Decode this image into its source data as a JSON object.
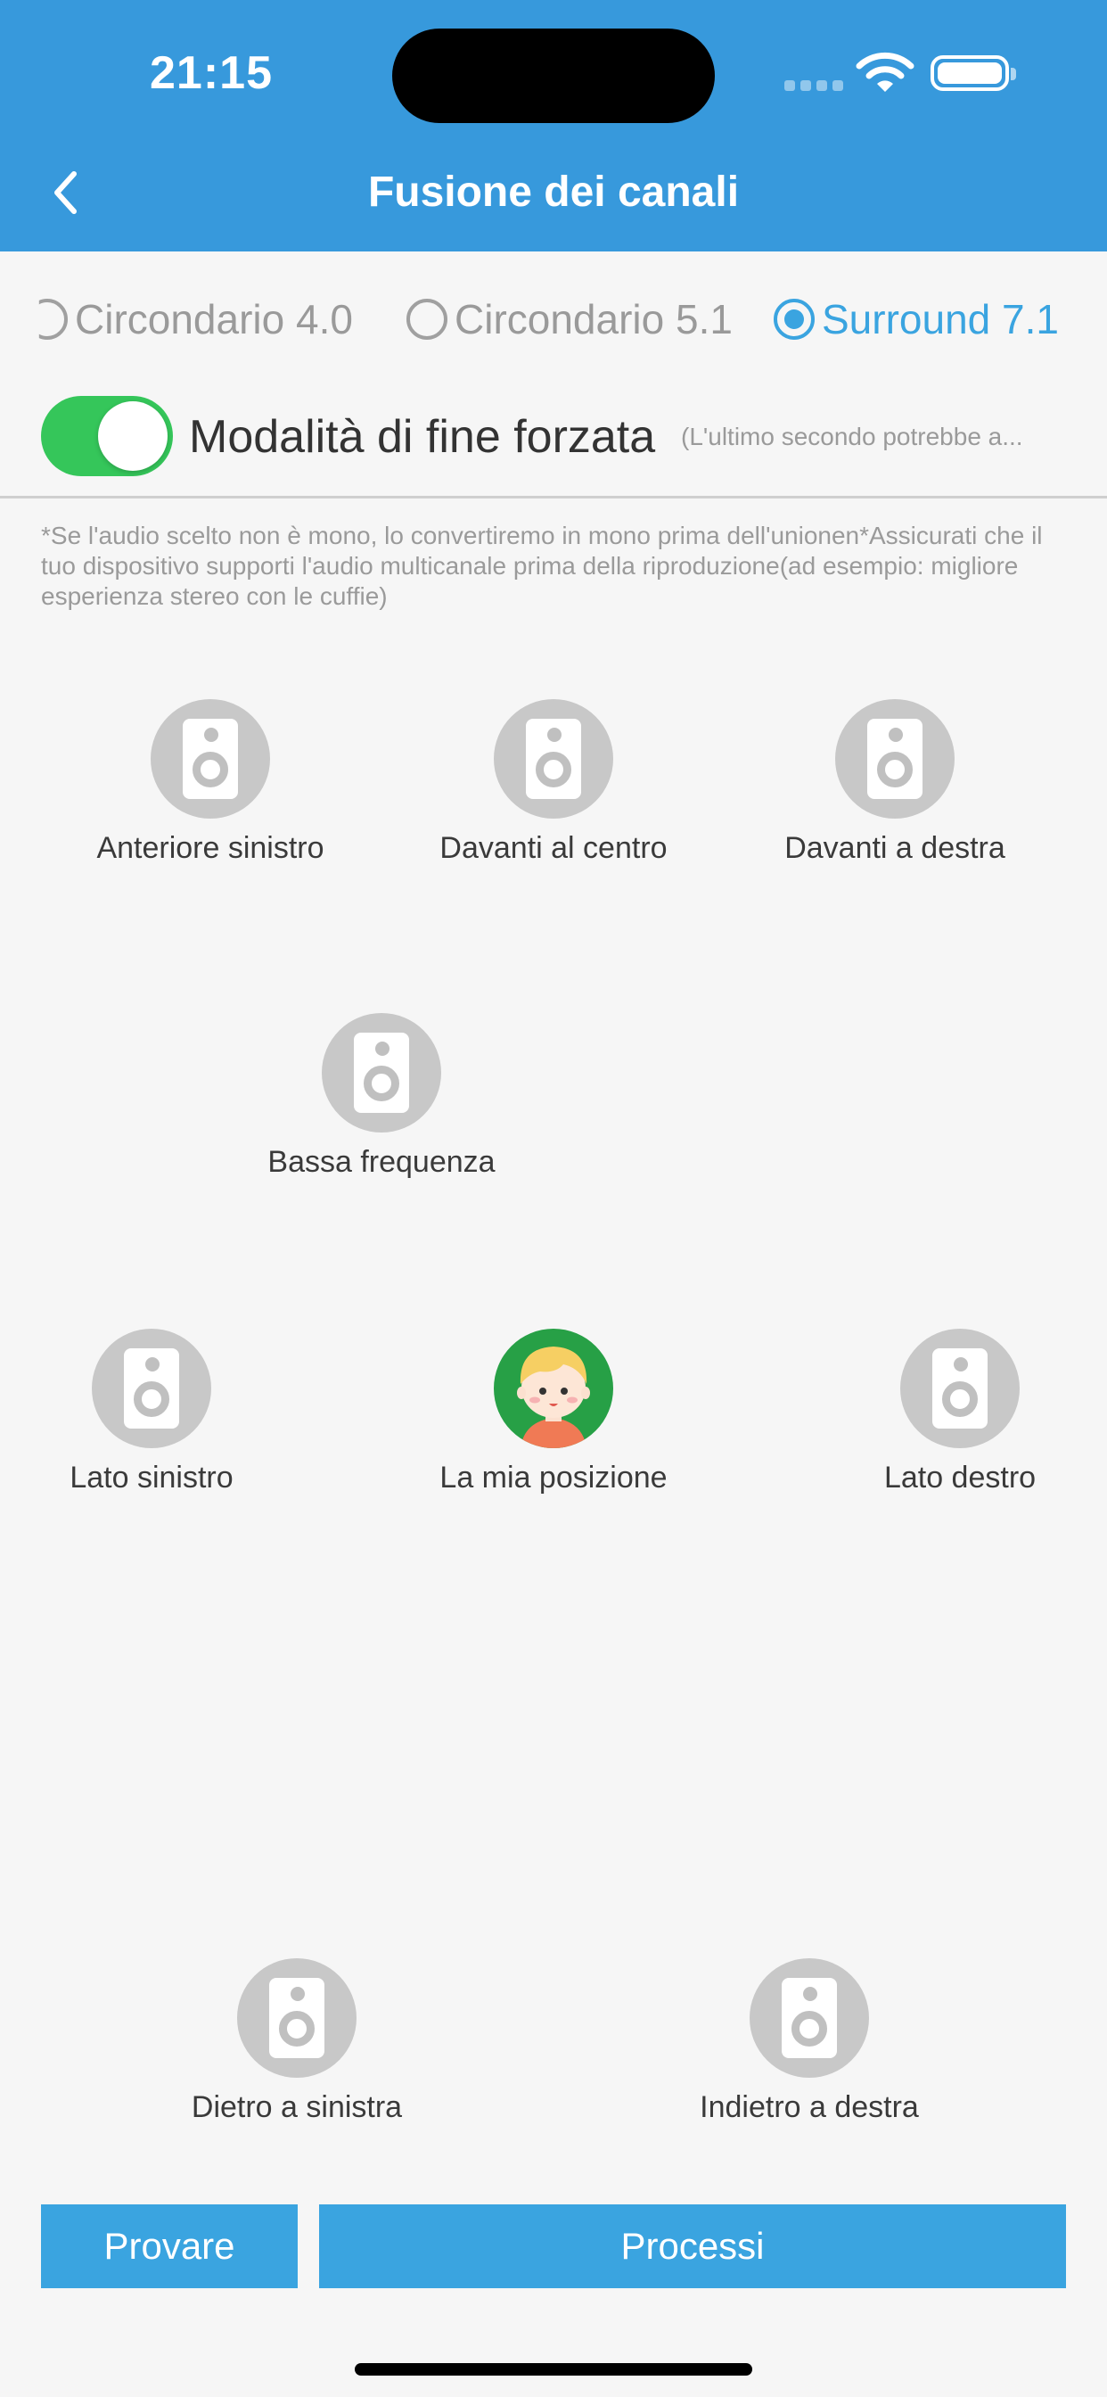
{
  "status_bar": {
    "time": "21:15"
  },
  "header": {
    "title": "Fusione dei canali"
  },
  "modes": [
    {
      "label": "Circondario 4.0",
      "selected": false
    },
    {
      "label": "Circondario 5.1",
      "selected": false
    },
    {
      "label": "Surround 7.1",
      "selected": true
    }
  ],
  "forced_end": {
    "label": "Modalità di fine forzata",
    "note": "(L'ultimo secondo potrebbe a...",
    "enabled": true
  },
  "notice": "*Se l'audio scelto non è mono, lo convertiremo in mono prima dell'unionen*Assicurati che il tuo dispositivo supporti l'audio multicanale prima della riproduzione(ad esempio: migliore esperienza stereo con le cuffie)",
  "speakers": {
    "front_left": "Anteriore sinistro",
    "front_center": "Davanti al centro",
    "front_right": "Davanti a destra",
    "low_frequency": "Bassa frequenza",
    "side_left": "Lato sinistro",
    "my_position": "La mia posizione",
    "side_right": "Lato destro",
    "back_left": "Dietro a sinistra",
    "back_right": "Indietro a destra"
  },
  "buttons": {
    "try": "Provare",
    "process": "Processi"
  },
  "colors": {
    "header": "#3799dc",
    "accent": "#3aa4e0",
    "toggle_on": "#35c65a",
    "speaker": "#c8c8c8",
    "me": "#27a046"
  }
}
